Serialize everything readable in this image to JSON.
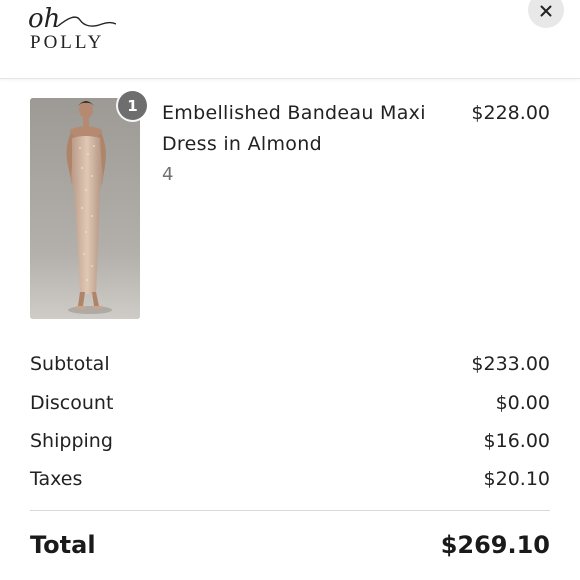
{
  "header": {
    "logo_top": "oh",
    "logo_bottom": "POLLY",
    "close_label": "×"
  },
  "cart_item": {
    "quantity": "1",
    "name": "Embellished Bandeau Maxi Dress in Almond",
    "variant": "4",
    "price": "$228.00"
  },
  "summary": {
    "rows": [
      {
        "label": "Subtotal",
        "value": "$233.00"
      },
      {
        "label": "Discount",
        "value": "$0.00"
      },
      {
        "label": "Shipping",
        "value": "$16.00"
      },
      {
        "label": "Taxes",
        "value": "$20.10"
      }
    ],
    "total_label": "Total",
    "total_value": "$269.10"
  },
  "colors": {
    "badge": "#6e6e6e",
    "close_bg": "#e8e8e8",
    "image_bg": "#a9a6a1",
    "dress": "#c9ad98"
  },
  "icons": {
    "close": "close-icon"
  }
}
